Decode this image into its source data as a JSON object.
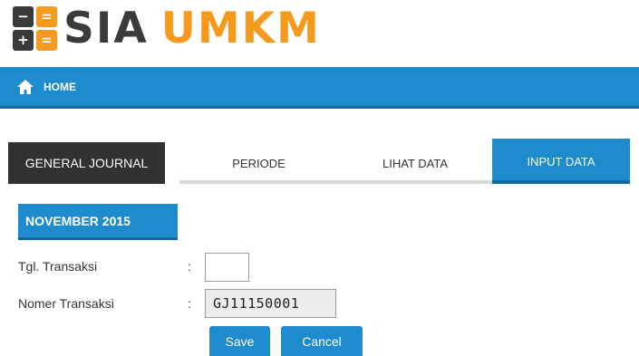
{
  "logo": {
    "sia": "SIA",
    "umkm": "UMKM",
    "icon_glyphs": [
      "−",
      "=",
      "+",
      "="
    ]
  },
  "nav": {
    "home_label": "HOME",
    "home_icon": "home-icon"
  },
  "tabs": {
    "module": "GENERAL JOURNAL",
    "items": [
      {
        "label": "PERIODE",
        "active": false
      },
      {
        "label": "LIHAT DATA",
        "active": false
      },
      {
        "label": "INPUT DATA",
        "active": true
      }
    ]
  },
  "period": {
    "label": "NOVEMBER 2015"
  },
  "form": {
    "tgl_label": "Tgl. Transaksi",
    "tgl_value": "",
    "nomer_label": "Nomer Transaksi",
    "nomer_value": "GJ11150001",
    "colon": ":"
  },
  "buttons": {
    "save": "Save",
    "cancel": "Cancel"
  },
  "colors": {
    "primary": "#1d8bcc",
    "primary_dark": "#0e6aa2",
    "accent": "#f59a1c",
    "dark": "#313131"
  }
}
